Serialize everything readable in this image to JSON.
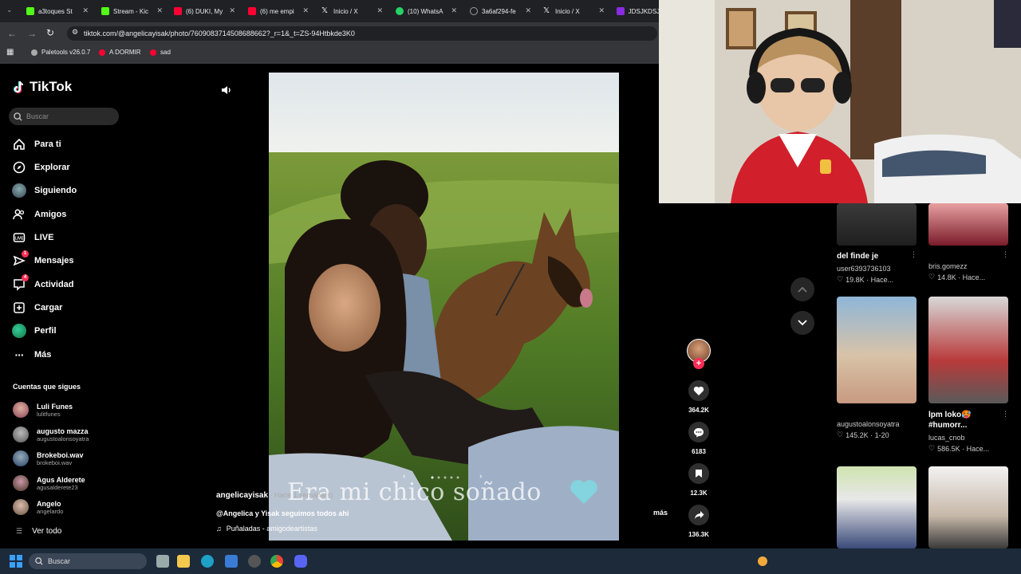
{
  "browser": {
    "tabs": [
      {
        "title": "a3toques St",
        "color": "#53fc18"
      },
      {
        "title": "Stream - Kic",
        "color": "#53fc18"
      },
      {
        "title": "(6) DUKI, My",
        "color": "#ff0033"
      },
      {
        "title": "(6) me empi",
        "color": "#ff0033"
      },
      {
        "title": "Inicio / X",
        "color": "#ffffff"
      },
      {
        "title": "(10) WhatsA",
        "color": "#25d366"
      },
      {
        "title": "3a6af294-fe",
        "color": "#9aa0a6"
      },
      {
        "title": "Inicio / X",
        "color": "#ffffff"
      },
      {
        "title": "JDSJKDSJA",
        "color": "#8a2be2"
      }
    ],
    "url": "tiktok.com/@angelicayisak/photo/7609083714508688662?_r=1&_t=ZS-94Htbkde3K0",
    "bookmarks": [
      {
        "label": "Paletools v26.0.7",
        "color": "#aaaaaa"
      },
      {
        "label": "A DORMIR",
        "color": "#ff0033"
      },
      {
        "label": "sad",
        "color": "#ff0033"
      }
    ]
  },
  "tiktok": {
    "logo_text": "TikTok",
    "search_placeholder": "Buscar",
    "nav": [
      {
        "label": "Para ti",
        "icon": "home-icon"
      },
      {
        "label": "Explorar",
        "icon": "compass-icon"
      },
      {
        "label": "Siguiendo",
        "icon": "following-avatar-icon"
      },
      {
        "label": "Amigos",
        "icon": "friends-icon"
      },
      {
        "label": "LIVE",
        "icon": "live-icon"
      },
      {
        "label": "Mensajes",
        "icon": "messages-icon",
        "badge": "1"
      },
      {
        "label": "Actividad",
        "icon": "activity-icon",
        "badge": "4"
      },
      {
        "label": "Cargar",
        "icon": "upload-icon"
      },
      {
        "label": "Perfil",
        "icon": "profile-icon"
      },
      {
        "label": "Más",
        "icon": "more-icon"
      }
    ],
    "following_title": "Cuentas que sigues",
    "following": [
      {
        "name": "Luli Funes",
        "handle": "lulitfunes",
        "color": "#c98a7a"
      },
      {
        "name": "augusto mazza",
        "handle": "augustoalonsoyatra",
        "color": "#8a8a8a"
      },
      {
        "name": "Brokeboi.wav",
        "handle": "brokeboi.wav",
        "color": "#5a6a8a"
      },
      {
        "name": "Agus Alderete",
        "handle": "agusalderete23",
        "color": "#6a5a4a"
      },
      {
        "name": "Angelo",
        "handle": "angelardo",
        "color": "#9a7a6a"
      }
    ],
    "see_all": "Ver todo"
  },
  "post": {
    "overlay_text": "Era mi chico soñado",
    "author": "angelicayisak",
    "age": " · Hace 1 semana(s)",
    "description": "@Angelica y Yisak seguimos todos ahi",
    "music": "Puñaladas - amigodeartistas",
    "more_label": "más",
    "likes": "364.2K",
    "comments": "6183",
    "saves": "12.3K",
    "shares": "136.3K"
  },
  "grid": [
    {
      "title": "del finde je",
      "user": "user6393736103",
      "meta": "19.8K · Hace..."
    },
    {
      "title": "",
      "user": "bris.gomezz",
      "meta": "14.8K · Hace..."
    },
    {
      "title": "",
      "user": "augustoalonsoyatra",
      "meta": "145.2K · 1-20"
    },
    {
      "title": "lpm loko🥵 #humorr...",
      "user": "lucas_cnob",
      "meta": "586.5K · Hace..."
    }
  ],
  "taskbar": {
    "search_placeholder": "Buscar"
  }
}
